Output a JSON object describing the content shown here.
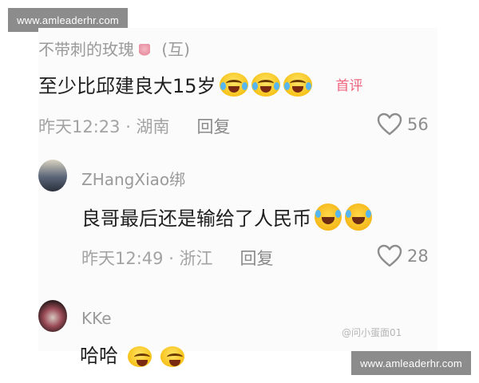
{
  "watermarks": {
    "top": "www.amleaderhr.com",
    "bottom": "www.amleaderhr.com"
  },
  "comments": [
    {
      "username": "不带刺的玫瑰",
      "username_suffix": "(互)",
      "content": "至少比邱建良大15岁",
      "badge": "首评",
      "meta": "昨天12:23 · 湖南",
      "reply": "回复",
      "likes": "56"
    },
    {
      "username": "ZHangXiao绑",
      "content": "良哥最后还是输给了人民币",
      "meta": "昨天12:49 · 浙江",
      "reply": "回复",
      "likes": "28"
    },
    {
      "username": "KKe",
      "content": "哈哈"
    }
  ],
  "source_mark": "@问小蛋面01",
  "icons": {
    "like": "heart-outline-icon",
    "emoji": "laughing-crying-emoji"
  },
  "colors": {
    "badge": "#f0637d",
    "text": "#1f1f1f",
    "meta": "#a3a3a3"
  }
}
